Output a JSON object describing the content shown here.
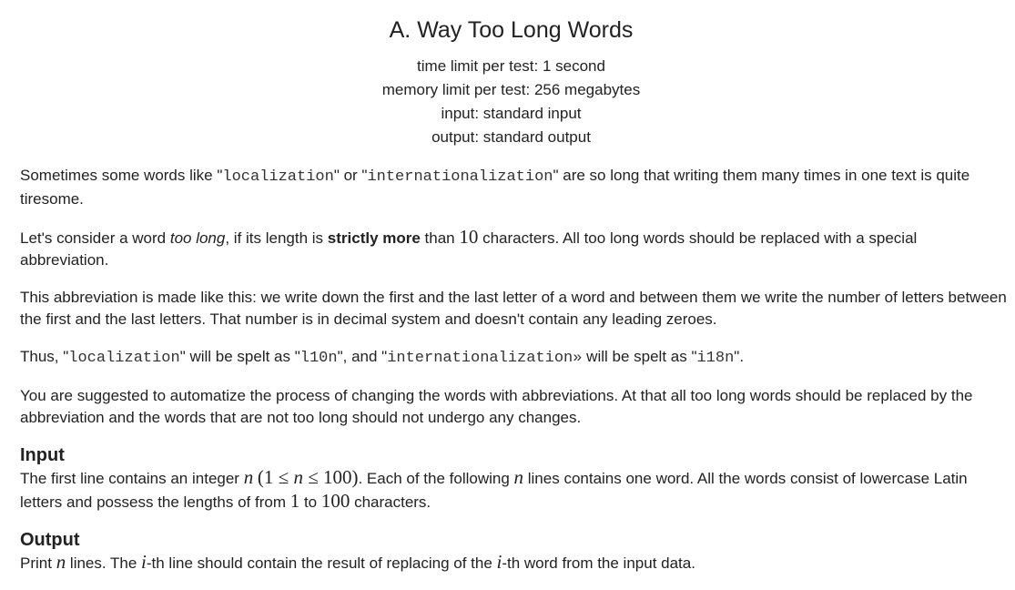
{
  "problem": {
    "title": "A. Way Too Long Words",
    "limits": {
      "time": "time limit per test: 1 second",
      "memory": "memory limit per test: 256 megabytes",
      "input": "input: standard input",
      "output": "output: standard output"
    }
  },
  "statement": {
    "p1": {
      "t1": "Sometimes some words like \"",
      "c1": "localization",
      "t2": "\" or \"",
      "c2": "internationalization",
      "t3": "\" are so long that writing them many times in one text is quite tiresome."
    },
    "p2": {
      "t1": "Let's consider a word ",
      "em": "too long",
      "t2": ", if its length is ",
      "strong": "strictly more",
      "t3": " than ",
      "m1": "10",
      "t4": " characters. All too long words should be replaced with a special abbreviation."
    },
    "p3": {
      "text": "This abbreviation is made like this: we write down the first and the last letter of a word and between them we write the number of letters between the first and the last letters. That number is in decimal system and doesn't contain any leading zeroes."
    },
    "p4": {
      "t1": "Thus, \"",
      "c1": "localization",
      "t2": "\" will be spelt as \"",
      "c2": "l10n",
      "t3": "\", and \"",
      "c3": "internationalization»",
      "t4": " will be spelt as \"",
      "c4": "i18n",
      "t5": "\"."
    },
    "p5": {
      "text": "You are suggested to automatize the process of changing the words with abbreviations. At that all too long words should be replaced by the abbreviation and the words that are not too long should not undergo any changes."
    }
  },
  "input_section": {
    "title": "Input",
    "t1": "The first line contains an integer ",
    "m1": "n",
    "m2a": "(1 ≤ ",
    "m2b": "n",
    "m2c": " ≤ 100)",
    "t2": ". Each of the following ",
    "m3": "n",
    "t3": " lines contains one word. All the words consist of lowercase Latin letters and possess the lengths of from ",
    "m4": "1",
    "t4": " to ",
    "m5": "100",
    "t5": " characters."
  },
  "output_section": {
    "title": "Output",
    "t1": "Print ",
    "m1": "n",
    "t2": " lines. The ",
    "m2": "i",
    "t3": "-th line should contain the result of replacing of the ",
    "m3": "i",
    "t4": "-th word from the input data."
  }
}
